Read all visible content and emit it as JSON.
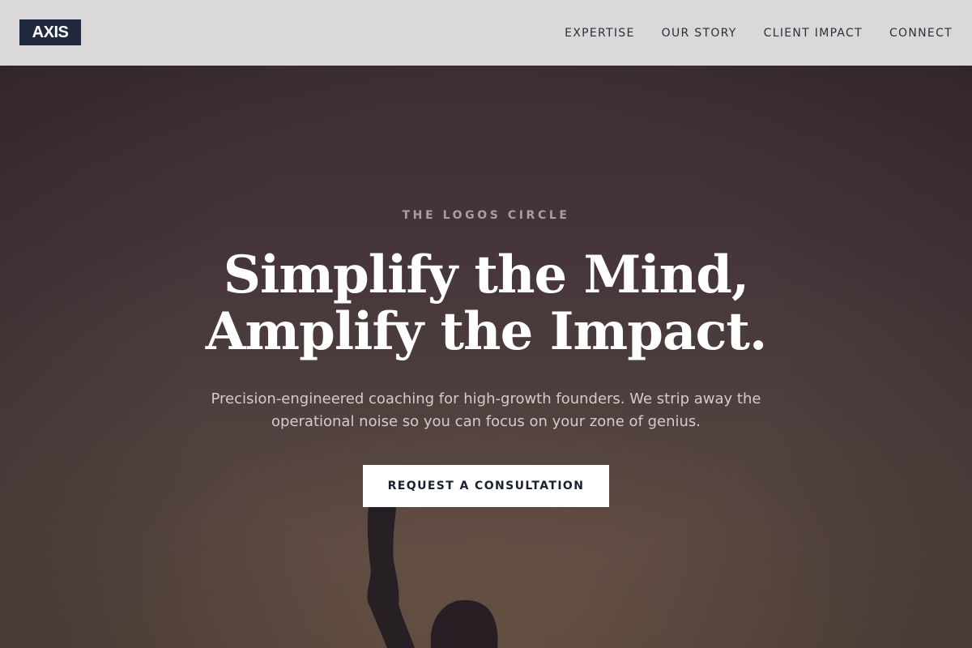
{
  "header": {
    "logo": "AXIS",
    "nav": [
      {
        "label": "EXPERTISE"
      },
      {
        "label": "OUR STORY"
      },
      {
        "label": "CLIENT IMPACT"
      },
      {
        "label": "CONNECT"
      }
    ]
  },
  "hero": {
    "eyebrow": "THE LOGOS CIRCLE",
    "headline_line1": "Simplify the Mind,",
    "headline_line2": "Amplify the Impact.",
    "subtext": "Precision-engineered coaching for high-growth founders. We strip away the operational noise so you can focus on your zone of genius.",
    "cta_label": "REQUEST A CONSULTATION"
  },
  "colors": {
    "header_bg": "#dbd8d9",
    "logo_bg": "#1f2a3f",
    "hero_bg": "#45353a",
    "cta_bg": "#ffffff",
    "cta_text": "#1a2030"
  }
}
